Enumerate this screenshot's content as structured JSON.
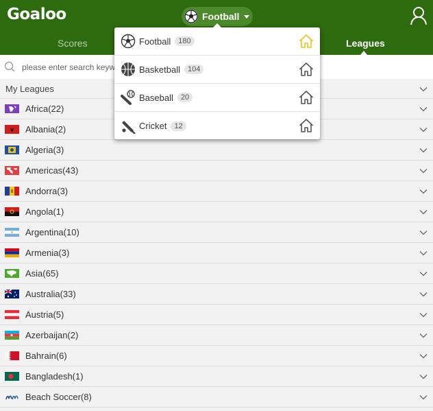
{
  "header": {
    "logo": "Goaloo",
    "current_sport": "Football",
    "tabs": [
      {
        "label": "Scores",
        "active": false
      },
      {
        "label": "Leagues",
        "active": true
      }
    ]
  },
  "search": {
    "placeholder": "please enter search keywords",
    "value": ""
  },
  "leagues": {
    "section_title": "My Leagues",
    "items": [
      {
        "label": "Africa(22)",
        "flag": "africa-flag"
      },
      {
        "label": "Albania(2)",
        "flag": "albania-flag"
      },
      {
        "label": "Algeria(3)",
        "flag": "algeria-flag"
      },
      {
        "label": "Americas(43)",
        "flag": "americas-flag"
      },
      {
        "label": "Andorra(3)",
        "flag": "andorra-flag"
      },
      {
        "label": "Angola(1)",
        "flag": "angola-flag"
      },
      {
        "label": "Argentina(10)",
        "flag": "argentina-flag"
      },
      {
        "label": "Armenia(3)",
        "flag": "armenia-flag"
      },
      {
        "label": "Asia(65)",
        "flag": "asia-flag"
      },
      {
        "label": "Australia(33)",
        "flag": "australia-flag"
      },
      {
        "label": "Austria(5)",
        "flag": "austria-flag"
      },
      {
        "label": "Azerbaijan(2)",
        "flag": "azerbaijan-flag"
      },
      {
        "label": "Bahrain(6)",
        "flag": "bahrain-flag"
      },
      {
        "label": "Bangladesh(1)",
        "flag": "bangladesh-flag"
      },
      {
        "label": "Beach Soccer(8)",
        "flag": "beach-soccer-icon"
      }
    ]
  },
  "sport_menu": {
    "items": [
      {
        "label": "Football",
        "count": "180",
        "icon": "football-icon",
        "home_active": true
      },
      {
        "label": "Basketball",
        "count": "104",
        "icon": "basketball-icon",
        "home_active": false
      },
      {
        "label": "Baseball",
        "count": "20",
        "icon": "baseball-icon",
        "home_active": false
      },
      {
        "label": "Cricket",
        "count": "12",
        "icon": "cricket-icon",
        "home_active": false
      }
    ]
  },
  "colors": {
    "brand_green": "#2e6b0e",
    "home_active": "#e8c31a",
    "home_inactive": "#555555"
  }
}
